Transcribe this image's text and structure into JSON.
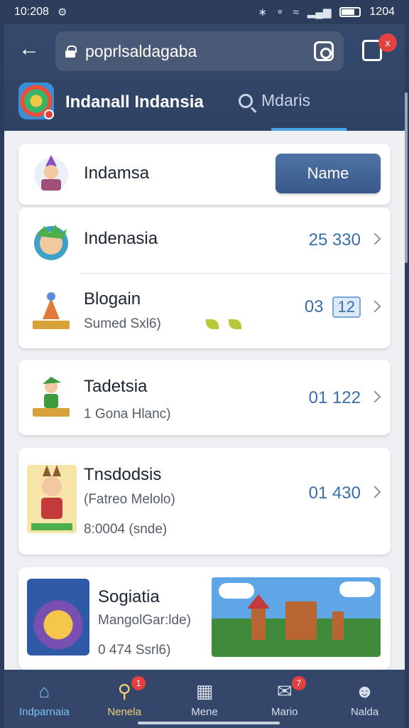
{
  "status_bar": {
    "time": "10:208",
    "right_text": "1204"
  },
  "browser": {
    "url": "poprlsaldagaba"
  },
  "app_header": {
    "title": "Indanall Indansia",
    "search_tab_label": "Mdaris",
    "tabs_badge": "x"
  },
  "cards": [
    {
      "rows": [
        {
          "title": "Indamsa",
          "button_label": "Name"
        }
      ]
    },
    {
      "rows": [
        {
          "title": "Indenasia",
          "value": "25 330"
        },
        {
          "title": "Blogain",
          "subtitle": "Sumed Sxl6)",
          "value": "03",
          "value_badge": "12"
        }
      ]
    },
    {
      "rows": [
        {
          "title": "Tadetsia",
          "subtitle": "1 Gona Hlanc)",
          "value": "01 122"
        }
      ]
    },
    {
      "rows": [
        {
          "title": "Tnsdodsis",
          "subtitle": "(Fatreo Melolo)",
          "subtitle2": "8:0004 (snde)",
          "value": "01 430"
        }
      ]
    },
    {
      "rows": [
        {
          "title": "Sogiatia",
          "subtitle": "MangolGar:lde)",
          "subtitle2": "0 474 Ssrl6)"
        }
      ]
    }
  ],
  "bottom_nav": [
    {
      "label": "Indparnaia",
      "icon": "home-icon"
    },
    {
      "label": "Nenela",
      "icon": "search-icon",
      "badge": "1"
    },
    {
      "label": "Mene",
      "icon": "grid-icon"
    },
    {
      "label": "Mario",
      "icon": "inbox-icon",
      "badge": "7"
    },
    {
      "label": "Nalda",
      "icon": "profile-icon"
    }
  ],
  "colors": {
    "header_bg": "#2e4264",
    "accent": "#4aa6e8",
    "value_text": "#3a6ea8",
    "badge_red": "#e34040"
  }
}
